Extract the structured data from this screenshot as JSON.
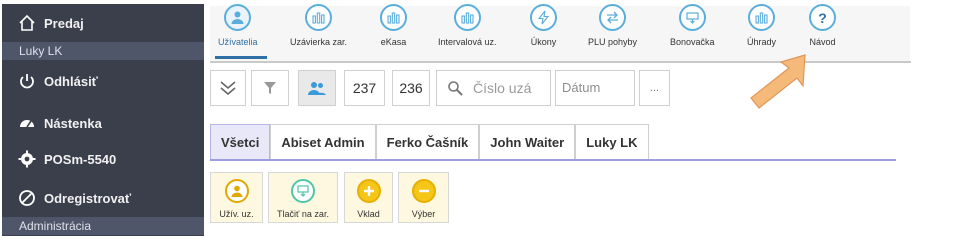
{
  "sidebar": {
    "home_label": "Predaj",
    "user_name": "Luky LK",
    "logout_label": "Odhlásiť",
    "dashboard_label": "Nástenka",
    "pos_label": "POSm-5540",
    "unregister_label": "Odregistrovať",
    "admin_label": "Administrácia"
  },
  "ribbon": {
    "items": [
      {
        "label": "Užívatelia",
        "icon": "users-icon"
      },
      {
        "label": "Uzávierka zar.",
        "icon": "chart-icon"
      },
      {
        "label": "eKasa",
        "icon": "chart-icon"
      },
      {
        "label": "Intervalová uz.",
        "icon": "chart-icon"
      },
      {
        "label": "Úkony",
        "icon": "lightning-icon"
      },
      {
        "label": "PLU pohyby",
        "icon": "transfer-icon"
      },
      {
        "label": "Bonovačka",
        "icon": "printer-icon"
      },
      {
        "label": "Úhrady",
        "icon": "chart-icon"
      },
      {
        "label": "Návod",
        "icon": "question-icon"
      }
    ],
    "active_index": 0
  },
  "toolbar": {
    "count_a": "237",
    "count_b": "236",
    "search_placeholder": "Číslo uzá",
    "date_placeholder": "Dátum",
    "more_label": "..."
  },
  "tabs": [
    "Všetci",
    "Abiset Admin",
    "Ferko Čašník",
    "John Waiter",
    "Luky LK"
  ],
  "actions": [
    {
      "label": "Užív. uz.",
      "icon": "user-icon"
    },
    {
      "label": "Tlačiť na zar.",
      "icon": "print-icon"
    },
    {
      "label": "Vklad",
      "icon": "plus-icon"
    },
    {
      "label": "Výber",
      "icon": "minus-icon"
    }
  ],
  "colors": {
    "sidebar_bg": "#3b3f4c",
    "ribbon_circle": "#5aaedc",
    "tab_underline": "#9d9de0",
    "action_bg": "#fff8e1",
    "arrow": "#f5b97a"
  }
}
